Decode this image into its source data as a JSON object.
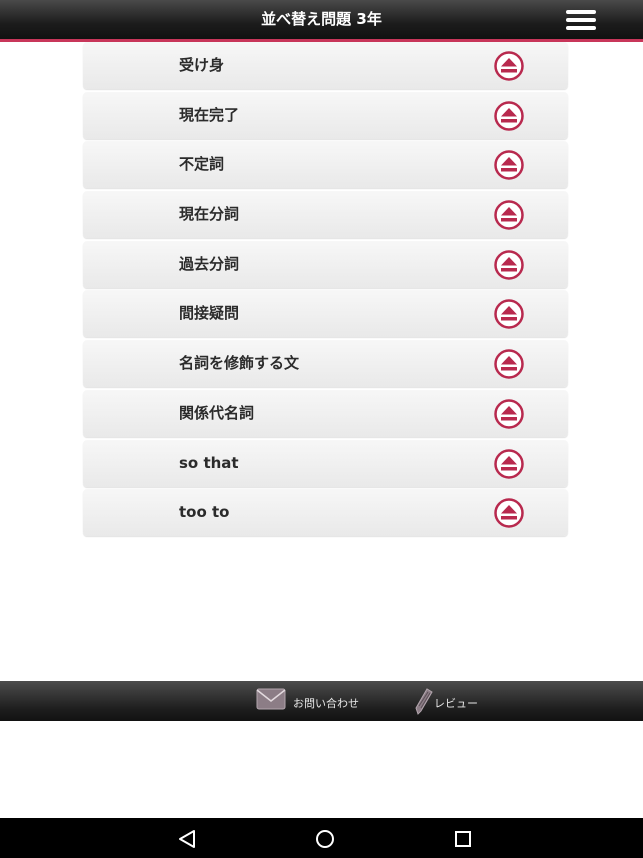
{
  "header": {
    "title": "並べ替え問題 3年",
    "menu_icon": "hamburger-menu-icon"
  },
  "items": [
    {
      "label": "受け身",
      "icon": "eject-icon"
    },
    {
      "label": "現在完了",
      "icon": "eject-icon"
    },
    {
      "label": "不定詞",
      "icon": "eject-icon"
    },
    {
      "label": "現在分詞",
      "icon": "eject-icon"
    },
    {
      "label": "過去分詞",
      "icon": "eject-icon"
    },
    {
      "label": "間接疑問",
      "icon": "eject-icon"
    },
    {
      "label": "名詞を修飾する文",
      "icon": "eject-icon"
    },
    {
      "label": "関係代名詞",
      "icon": "eject-icon"
    },
    {
      "label": "so that",
      "icon": "eject-icon"
    },
    {
      "label": "too to",
      "icon": "eject-icon"
    }
  ],
  "footer": {
    "contact_label": "お問い合わせ",
    "review_label": "レビュー"
  },
  "nav": {
    "back": "back-triangle-icon",
    "home": "home-circle-icon",
    "recents": "recents-square-icon"
  },
  "colors": {
    "accent": "#c8365a",
    "icon": "#b8294e",
    "header": "#1c1c1c"
  }
}
